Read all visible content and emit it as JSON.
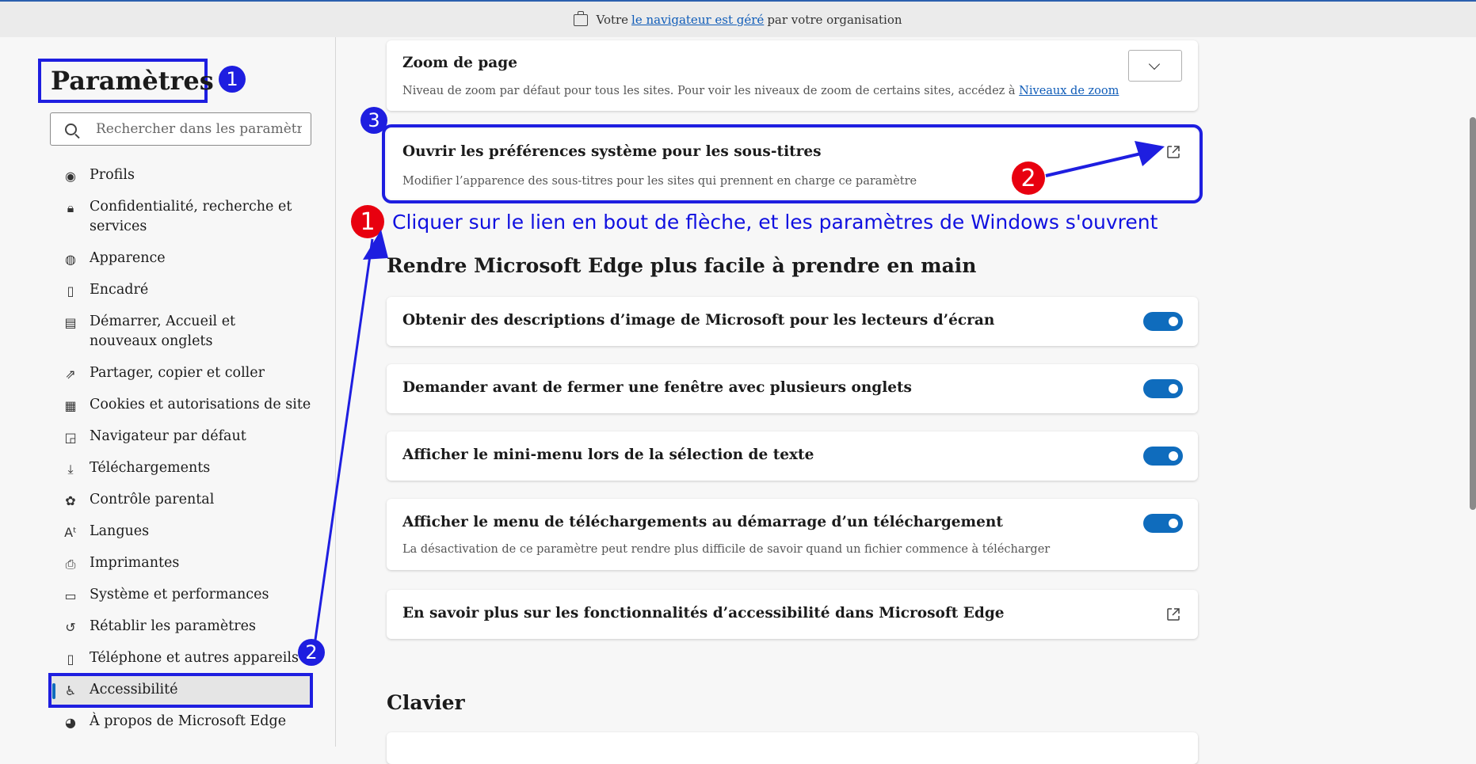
{
  "banner": {
    "prefix": "Votre",
    "link": "le navigateur est géré",
    "suffix": "par votre organisation"
  },
  "sidebar": {
    "title": "Paramètres",
    "search_placeholder": "Rechercher dans les paramètres",
    "items": [
      {
        "label": "Profils",
        "icon": "profile-icon"
      },
      {
        "label": "Confidentialité, recherche et services",
        "icon": "lock-icon"
      },
      {
        "label": "Apparence",
        "icon": "palette-icon"
      },
      {
        "label": "Encadré",
        "icon": "sidebar-panel-icon"
      },
      {
        "label": "Démarrer, Accueil et nouveaux onglets",
        "icon": "home-tabs-icon"
      },
      {
        "label": "Partager, copier et coller",
        "icon": "share-icon"
      },
      {
        "label": "Cookies et autorisations de site",
        "icon": "cookies-icon"
      },
      {
        "label": "Navigateur par défaut",
        "icon": "default-browser-icon"
      },
      {
        "label": "Téléchargements",
        "icon": "download-icon"
      },
      {
        "label": "Contrôle parental",
        "icon": "family-icon"
      },
      {
        "label": "Langues",
        "icon": "language-icon"
      },
      {
        "label": "Imprimantes",
        "icon": "printer-icon"
      },
      {
        "label": "Système et performances",
        "icon": "laptop-icon"
      },
      {
        "label": "Rétablir les paramètres",
        "icon": "reset-icon"
      },
      {
        "label": "Téléphone et autres appareils",
        "icon": "phone-icon"
      },
      {
        "label": "Accessibilité",
        "icon": "accessibility-icon",
        "active": true
      },
      {
        "label": "À propos de Microsoft Edge",
        "icon": "edge-logo-icon"
      }
    ]
  },
  "main": {
    "zoom": {
      "title": "Zoom de page",
      "desc": "Niveau de zoom par défaut pour tous les sites. Pour voir les niveaux de zoom de certains sites, accédez à",
      "link": "Niveaux de zoom"
    },
    "captions": {
      "title": "Ouvrir les préférences système pour les sous-titres",
      "desc": "Modifier l’apparence des sous-titres pour les sites qui prennent en charge ce paramètre"
    },
    "section_easy": "Rendre Microsoft Edge plus facile à prendre en main",
    "toggles": [
      {
        "title": "Obtenir des descriptions d’image de Microsoft pour les lecteurs d’écran",
        "on": true
      },
      {
        "title": "Demander avant de fermer une fenêtre avec plusieurs onglets",
        "on": true
      },
      {
        "title": "Afficher le mini-menu lors de la sélection de texte",
        "on": true
      },
      {
        "title": "Afficher le menu de téléchargements au démarrage d’un téléchargement",
        "desc": "La désactivation de ce paramètre peut rendre plus difficile de savoir quand un fichier commence à télécharger",
        "on": true
      }
    ],
    "learn_more": "En savoir plus sur les fonctionnalités d’accessibilité dans Microsoft Edge",
    "section_keyboard": "Clavier"
  },
  "annotations": {
    "instruction": "Cliquer sur le lien en bout de flèche, et les paramètres de Windows s'ouvrent",
    "badge_1": "1",
    "badge_2": "2",
    "badge_3": "3",
    "accent_blue": "#1e1ee0",
    "accent_red": "#e8000f"
  }
}
